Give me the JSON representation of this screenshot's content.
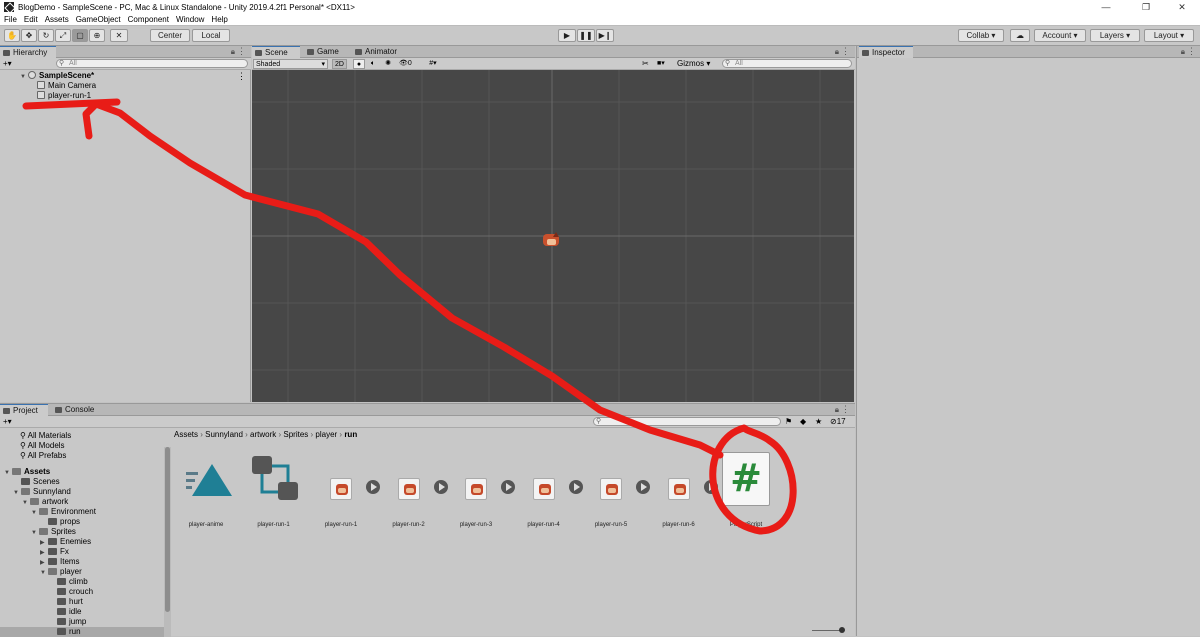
{
  "window": {
    "title": "BlogDemo - SampleScene - PC, Mac & Linux Standalone - Unity 2019.4.2f1 Personal* <DX11>",
    "minimize": "—",
    "maximize": "❐",
    "close": "✕"
  },
  "menu": [
    "File",
    "Edit",
    "Assets",
    "GameObject",
    "Component",
    "Window",
    "Help"
  ],
  "toolbar": {
    "center_label": "Center",
    "local_label": "Local",
    "collab_label": "Collab ▾",
    "account_label": "Account",
    "layers_label": "Layers",
    "layout_label": "Layout"
  },
  "hierarchy": {
    "tab": "Hierarchy",
    "search_placeholder": "All",
    "add_label": "+▾",
    "scene": "SampleScene*",
    "items": [
      "Main Camera",
      "player-run-1"
    ]
  },
  "scene": {
    "tabs": [
      "Scene",
      "Game",
      "Animator"
    ],
    "shading": "Shaded",
    "mode_2d": "2D",
    "hidden_count": "0",
    "gizmos": "Gizmos",
    "search_placeholder": "All"
  },
  "inspector": {
    "tab": "Inspector"
  },
  "project": {
    "tabs": [
      "Project",
      "Console"
    ],
    "add_label": "+▾",
    "count": "17",
    "favorites": [
      "All Materials",
      "All Models",
      "All Prefabs"
    ],
    "tree": [
      {
        "label": "Assets",
        "depth": 0,
        "bold": true,
        "arrow": "▼"
      },
      {
        "label": "Scenes",
        "depth": 1,
        "arrow": ""
      },
      {
        "label": "Sunnyland",
        "depth": 1,
        "arrow": "▼"
      },
      {
        "label": "artwork",
        "depth": 2,
        "arrow": "▼"
      },
      {
        "label": "Environment",
        "depth": 3,
        "arrow": "▼"
      },
      {
        "label": "props",
        "depth": 4,
        "arrow": ""
      },
      {
        "label": "Sprites",
        "depth": 3,
        "arrow": "▼"
      },
      {
        "label": "Enemies",
        "depth": 4,
        "arrow": "▶"
      },
      {
        "label": "Fx",
        "depth": 4,
        "arrow": "▶"
      },
      {
        "label": "Items",
        "depth": 4,
        "arrow": "▶"
      },
      {
        "label": "player",
        "depth": 4,
        "arrow": "▼"
      },
      {
        "label": "climb",
        "depth": 5,
        "arrow": ""
      },
      {
        "label": "crouch",
        "depth": 5,
        "arrow": ""
      },
      {
        "label": "hurt",
        "depth": 5,
        "arrow": ""
      },
      {
        "label": "idle",
        "depth": 5,
        "arrow": ""
      },
      {
        "label": "jump",
        "depth": 5,
        "arrow": ""
      },
      {
        "label": "run",
        "depth": 5,
        "arrow": "",
        "selected": true
      }
    ],
    "breadcrumb": [
      "Assets",
      "Sunnyland",
      "artwork",
      "Sprites",
      "player",
      "run"
    ],
    "assets": [
      {
        "label": "player-anime",
        "kind": "anim"
      },
      {
        "label": "player-run-1",
        "kind": "controller"
      },
      {
        "label": "player-run-1",
        "kind": "sprite"
      },
      {
        "label": "player-run-2",
        "kind": "sprite"
      },
      {
        "label": "player-run-3",
        "kind": "sprite"
      },
      {
        "label": "player-run-4",
        "kind": "sprite"
      },
      {
        "label": "player-run-5",
        "kind": "sprite"
      },
      {
        "label": "player-run-6",
        "kind": "sprite"
      },
      {
        "label": "PlayerScript",
        "kind": "script",
        "glyph": "#"
      }
    ]
  },
  "colors": {
    "annotation": "#e81c17",
    "script_green": "#2a8a3a",
    "anim_teal": "#1f7f95",
    "scene_bg": "#474747"
  }
}
